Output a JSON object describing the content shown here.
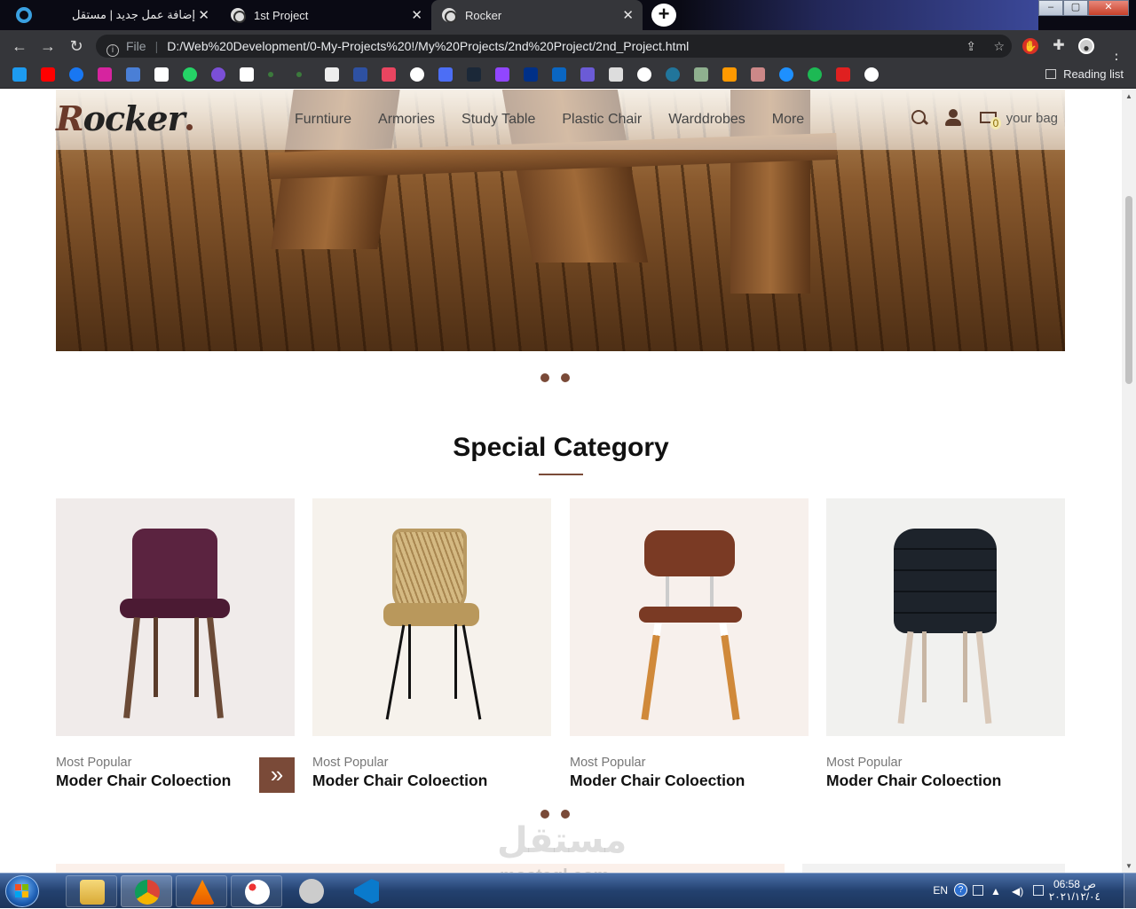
{
  "browser": {
    "tabs": [
      {
        "title": "إضافة عمل جديد | مستقل"
      },
      {
        "title": "1st Project"
      },
      {
        "title": "Rocker"
      }
    ],
    "address": {
      "scheme_label": "File",
      "url": "D:/Web%20Development/0-My-Projects%20!/My%20Projects/2nd%20Project/2nd_Project.html"
    },
    "reading_list": "Reading list",
    "window_controls": {
      "minimize": "–",
      "maximize": "▢",
      "close": "✕"
    }
  },
  "site": {
    "logo_first": "R",
    "logo_rest": "ocker",
    "menu": [
      "Furntiure",
      "Armories",
      "Study Table",
      "Plastic Chair",
      "Warddrobes",
      "More"
    ],
    "cart_count": "0",
    "bag_label": "your bag",
    "section_title": "Special Category",
    "cards": [
      {
        "small": "Most Popular",
        "title": "Moder Chair Coloection"
      },
      {
        "small": "Most Popular",
        "title": "Moder Chair Coloection"
      },
      {
        "small": "Most Popular",
        "title": "Moder Chair Coloection"
      },
      {
        "small": "Most Popular",
        "title": "Moder Chair Coloection"
      }
    ],
    "next_arrow": "»",
    "slider_dots": 2
  },
  "watermark": {
    "arabic": "مستقل",
    "latin": "mostaql.com"
  },
  "taskbar": {
    "language": "EN",
    "help": "?",
    "time": "06:58 ص",
    "date": "٢٠٢١/١٢/٠٤"
  },
  "colors": {
    "accent": "#7a4a38",
    "chrome_dark": "#35363a",
    "omnibox": "#202124",
    "taskbar": "#23416f"
  }
}
